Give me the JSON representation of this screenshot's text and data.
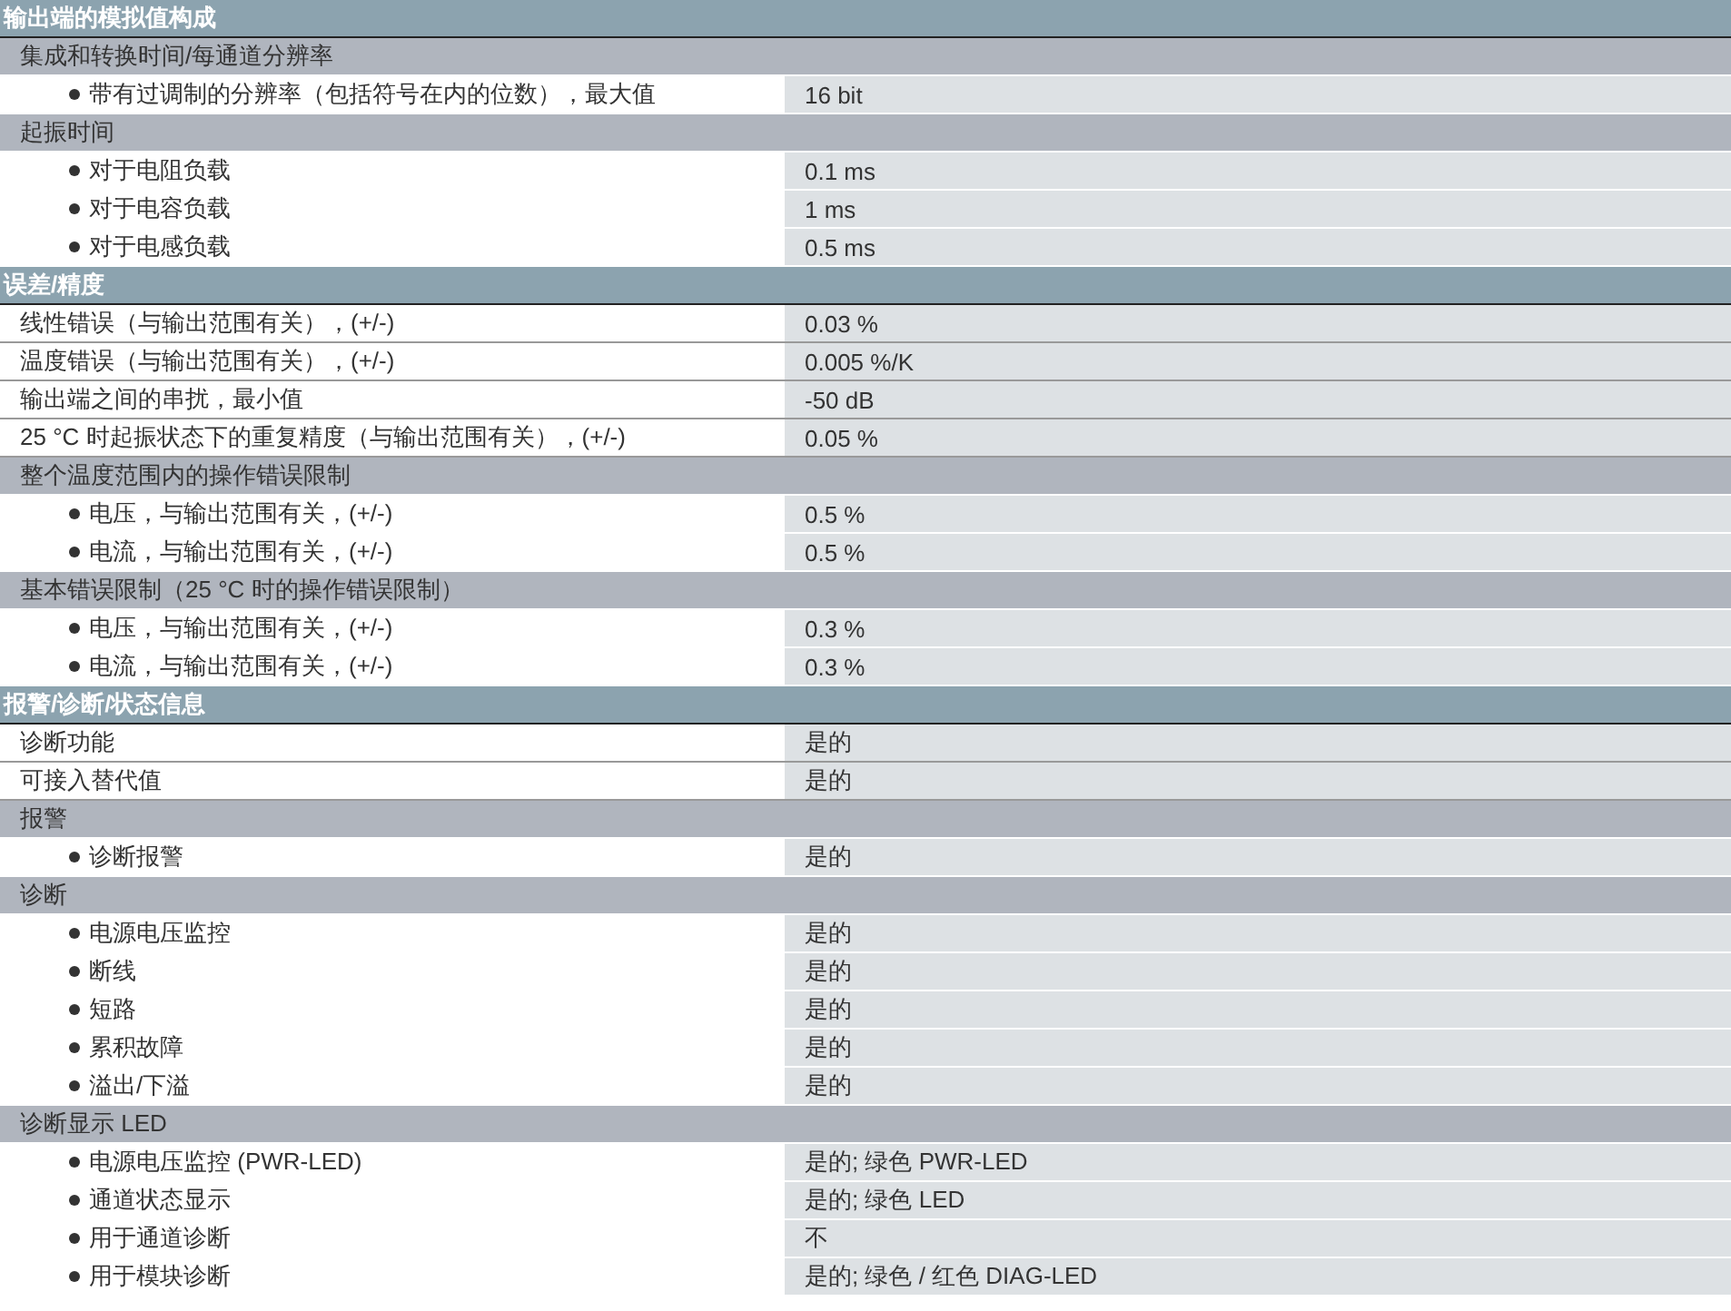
{
  "rows": [
    {
      "kind": "section",
      "label": "输出端的模拟值构成"
    },
    {
      "kind": "group",
      "label": "集成和转换时间/每通道分辨率"
    },
    {
      "kind": "row",
      "bullet": true,
      "label": "带有过调制的分辨率（包括符号在内的位数），最大值",
      "value": "16 bit"
    },
    {
      "kind": "group",
      "label": "起振时间"
    },
    {
      "kind": "row",
      "bullet": true,
      "label": "对于电阻负载",
      "value": "0.1 ms"
    },
    {
      "kind": "row",
      "bullet": true,
      "label": "对于电容负载",
      "value": "1 ms"
    },
    {
      "kind": "row",
      "bullet": true,
      "label": "对于电感负载",
      "value": "0.5 ms"
    },
    {
      "kind": "section",
      "label": "误差/精度"
    },
    {
      "kind": "row",
      "bullet": false,
      "label": "线性错误（与输出范围有关），(+/-)",
      "value": "0.03 %"
    },
    {
      "kind": "row",
      "bullet": false,
      "label": "温度错误（与输出范围有关），(+/-)",
      "value": "0.005 %/K"
    },
    {
      "kind": "row",
      "bullet": false,
      "label": "输出端之间的串扰，最小值",
      "value": "-50 dB"
    },
    {
      "kind": "row",
      "bullet": false,
      "label": "25 °C 时起振状态下的重复精度（与输出范围有关），(+/-)",
      "value": "0.05 %"
    },
    {
      "kind": "group",
      "label": "整个温度范围内的操作错误限制"
    },
    {
      "kind": "row",
      "bullet": true,
      "label": "电压，与输出范围有关，(+/-)",
      "value": "0.5 %"
    },
    {
      "kind": "row",
      "bullet": true,
      "label": "电流，与输出范围有关，(+/-)",
      "value": "0.5 %"
    },
    {
      "kind": "group",
      "label": "基本错误限制（25 °C 时的操作错误限制）"
    },
    {
      "kind": "row",
      "bullet": true,
      "label": "电压，与输出范围有关，(+/-)",
      "value": "0.3 %"
    },
    {
      "kind": "row",
      "bullet": true,
      "label": "电流，与输出范围有关，(+/-)",
      "value": "0.3 %"
    },
    {
      "kind": "section",
      "label": "报警/诊断/状态信息"
    },
    {
      "kind": "row",
      "bullet": false,
      "label": "诊断功能",
      "value": "是的"
    },
    {
      "kind": "row",
      "bullet": false,
      "label": "可接入替代值",
      "value": "是的"
    },
    {
      "kind": "group",
      "label": "报警"
    },
    {
      "kind": "row",
      "bullet": true,
      "label": "诊断报警",
      "value": "是的"
    },
    {
      "kind": "group",
      "label": "诊断"
    },
    {
      "kind": "row",
      "bullet": true,
      "label": "电源电压监控",
      "value": "是的"
    },
    {
      "kind": "row",
      "bullet": true,
      "label": "断线",
      "value": "是的"
    },
    {
      "kind": "row",
      "bullet": true,
      "label": "短路",
      "value": "是的"
    },
    {
      "kind": "row",
      "bullet": true,
      "label": "累积故障",
      "value": "是的"
    },
    {
      "kind": "row",
      "bullet": true,
      "label": "溢出/下溢",
      "value": "是的"
    },
    {
      "kind": "group",
      "label": "诊断显示 LED"
    },
    {
      "kind": "row",
      "bullet": true,
      "label": "电源电压监控 (PWR-LED)",
      "value": "是的; 绿色 PWR-LED"
    },
    {
      "kind": "row",
      "bullet": true,
      "label": "通道状态显示",
      "value": "是的; 绿色 LED"
    },
    {
      "kind": "row",
      "bullet": true,
      "label": "用于通道诊断",
      "value": "不"
    },
    {
      "kind": "row",
      "bullet": true,
      "label": "用于模块诊断",
      "value": "是的; 绿色 / 红色 DIAG-LED"
    }
  ]
}
